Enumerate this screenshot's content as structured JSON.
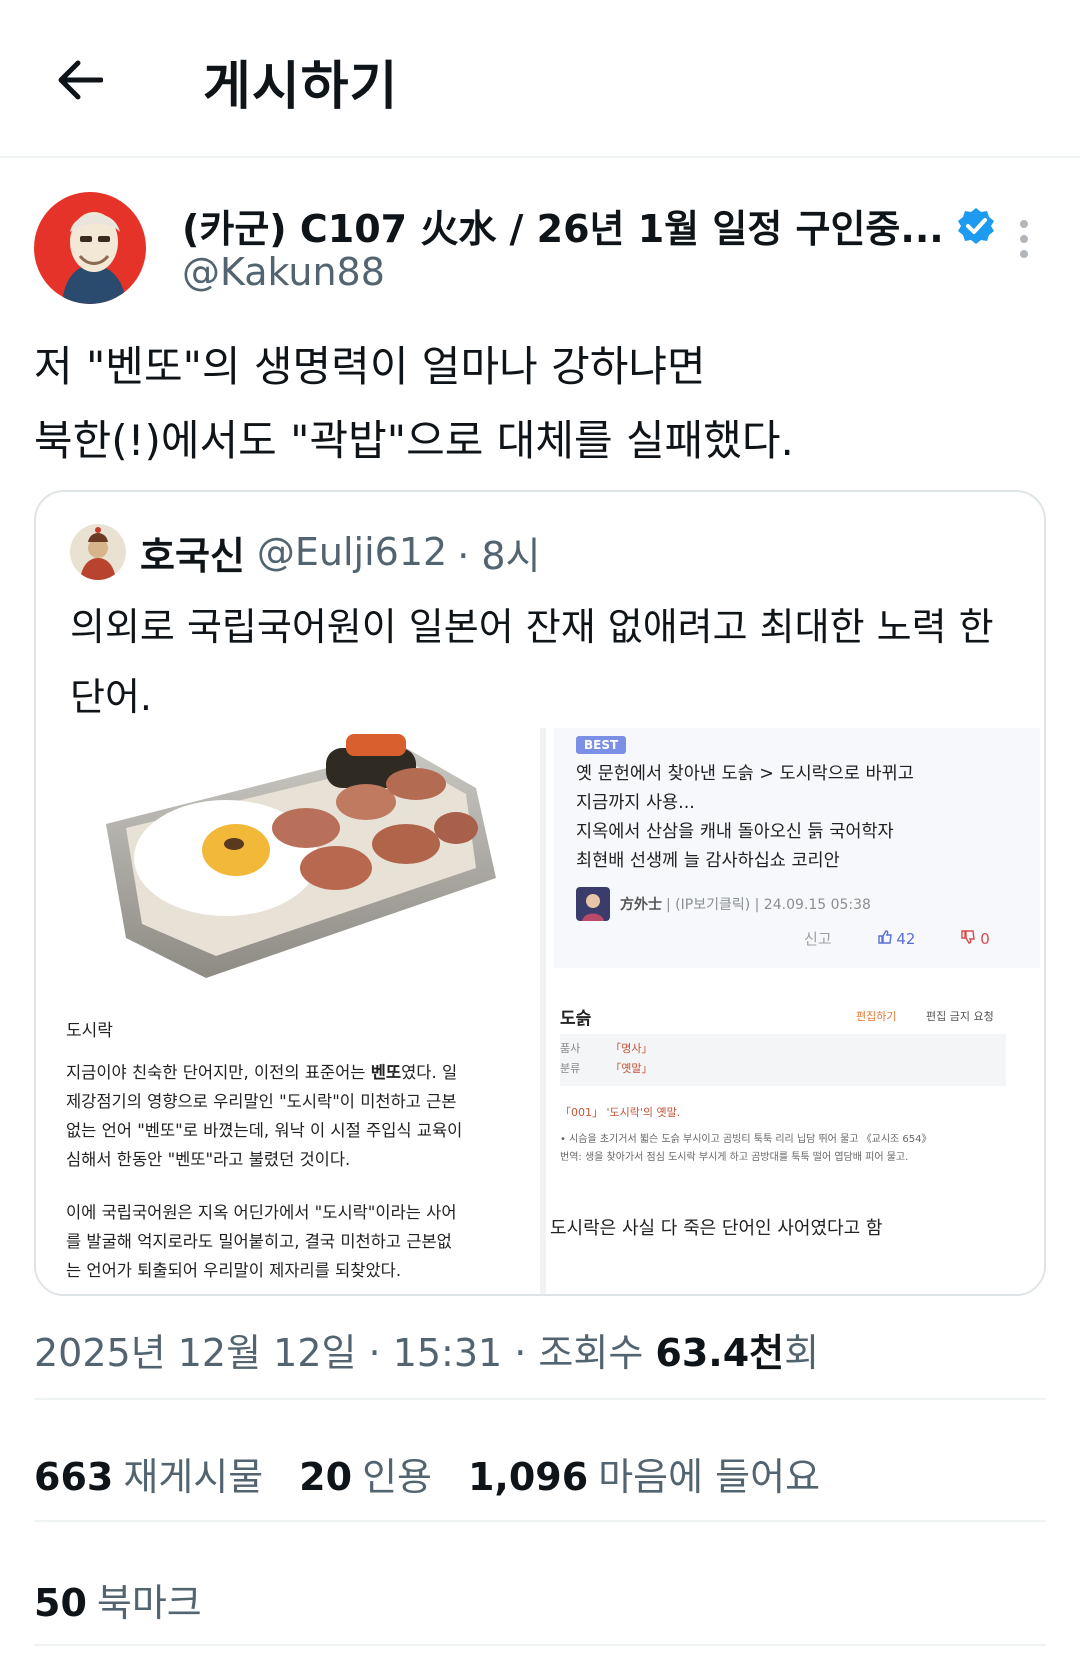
{
  "header": {
    "title": "게시하기"
  },
  "author": {
    "name": "(카군) C107 火水 / 26년 1월 일정 구인중...",
    "handle": "@Kakun88"
  },
  "tweet": {
    "lines": [
      "저 \"벤또\"의 생명력이 얼마나 강하냐면",
      "북한(!)에서도 \"곽밥\"으로 대체를 실패했다."
    ]
  },
  "quote": {
    "name": "호국신",
    "handle": "@Eulji612",
    "time": "· 8시",
    "lines": [
      "의외로 국립국어원이 일본어 잔재 없애려고 최대한 노력 한",
      "단어."
    ],
    "media_left": {
      "label": "도시락",
      "para1": [
        "지금이야 친숙한 단어지만, 이전의 표준어는 ",
        "벤또",
        "였다. 일",
        "제강점기의 영향으로 우리말인 \"도시락\"이 미천하고 근본",
        "없는 언어 \"벤또\"로 바꼈는데, 워낙 이 시절 주입식 교육이",
        "심해서 한동안 \"벤또\"라고 불렸던 것이다."
      ],
      "para2": [
        "이에 국립국어원은 지옥 어딘가에서 \"도시락\"이라는 사어",
        "를 발굴해 억지로라도 밀어붙히고, 결국 미천하고 근본없",
        "는 언어가 퇴출되어 우리말이 제자리를 되찾았다."
      ]
    },
    "media_right": {
      "badge": "BEST",
      "comment_lines": [
        "옛 문헌에서 찾아낸 도슭 > 도시락으로 바뀌고",
        "지금까지 사용...",
        "지옥에서 산삼을 캐내 돌아오신 듥 국어학자",
        "최현배 선생께 늘 감사하십쇼 코리안"
      ],
      "meta_user": "方外士",
      "meta_rest": "| (IP보기클릭) | 24.09.15 05:38",
      "report": "신고",
      "likes": "42",
      "dislikes": "0",
      "dict_title": "도슭",
      "dict_edit": "편집하기",
      "dict_noedit": "편집 금지 요청",
      "dict_rows": [
        {
          "k": "품사",
          "v": "「명사」"
        },
        {
          "k": "분류",
          "v": "「옛말」"
        }
      ],
      "dict_def": "「001」 '도시락'의 옛말.",
      "dict_ex1": "• 시슴을 초기거서 뷟슨 도슭 부시이고 곰빙티 툭툭 리리 닙담 뛰어 물고 《교시조 654》",
      "dict_ex2": "번역: 생을 찾아가서 점심 도시락 부시게 하고 곰방대를 툭툭 떨어 엽담배 피어 물고.",
      "caption": "도시락은 사실 다 죽은 단어인 사어였다고 함"
    }
  },
  "timestamp": {
    "date": "2025년 12월 12일 · 15:31 · 조회수 ",
    "views": "63.4천",
    "suffix": "회"
  },
  "stats": {
    "reposts_count": "663",
    "reposts_label": "재게시물",
    "quotes_count": "20",
    "quotes_label": "인용",
    "likes_count": "1,096",
    "likes_label": "마음에 들어요",
    "bookmarks_count": "50",
    "bookmarks_label": "북마크"
  },
  "colors": {
    "text": "#0f1419",
    "secondary": "#536471",
    "verified": "#1d9bf0",
    "border": "#eff3f4"
  },
  "icons": [
    "back-arrow-icon",
    "verified-badge-icon",
    "more-options-icon",
    "like-icon",
    "dislike-icon"
  ]
}
